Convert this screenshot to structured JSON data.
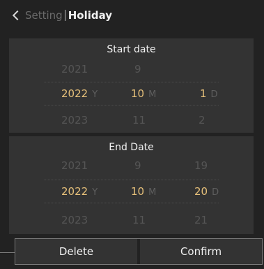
{
  "header": {
    "back_icon": "chevron-left-icon",
    "parent_label": "Setting",
    "title": "Holiday"
  },
  "start": {
    "title": "Start date",
    "prev": {
      "year": "2021",
      "month": "9"
    },
    "selected": {
      "year": "2022",
      "year_unit": "Y",
      "month": "10",
      "month_unit": "M",
      "day": "1",
      "day_unit": "D"
    },
    "next": {
      "year": "2023",
      "month": "11",
      "day": "2"
    }
  },
  "end": {
    "title": "End Date",
    "prev": {
      "year": "2021",
      "month": "9",
      "day": "19"
    },
    "selected": {
      "year": "2022",
      "year_unit": "Y",
      "month": "10",
      "month_unit": "M",
      "day": "20",
      "day_unit": "D"
    },
    "next": {
      "year": "2023",
      "month": "11",
      "day": "21"
    }
  },
  "footer": {
    "delete_label": "Delete",
    "confirm_label": "Confirm"
  },
  "colors": {
    "background": "#222222",
    "panel": "#333333",
    "selected_value": "#e6c07a",
    "inactive_value": "#555555"
  }
}
